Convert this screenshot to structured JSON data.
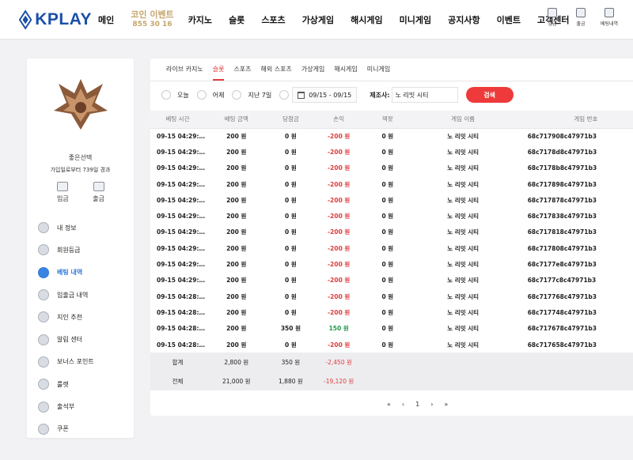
{
  "brand": {
    "name": "KPLAY"
  },
  "nav": {
    "items": [
      "메인",
      "카지노",
      "슬롯",
      "스포츠",
      "가상게임",
      "해시게임",
      "미니게임",
      "공지사항",
      "이벤트",
      "고객센터"
    ],
    "event": {
      "title": "코인 이벤트",
      "sub": "855 30 16"
    }
  },
  "header_icons": [
    "입금",
    "출금",
    "베팅내역"
  ],
  "user": {
    "name": "좋은선택",
    "since": "가입일로부터 739일 경과",
    "deposit_label": "입금",
    "withdraw_label": "출금"
  },
  "menu": {
    "items": [
      "내 정보",
      "회원등급",
      "베팅 내역",
      "입출금 내역",
      "지인 추천",
      "알림 센터",
      "보너스 포인트",
      "룰렛",
      "출석부",
      "쿠폰"
    ],
    "active_index": 2
  },
  "tabs": {
    "items": [
      "라이브 카지노",
      "슬롯",
      "스포츠",
      "해외 스포츠",
      "가상게임",
      "해시게임",
      "미니게임"
    ],
    "active_index": 1
  },
  "filters": {
    "today": "오늘",
    "yesterday": "어제",
    "last7": "지난 7일",
    "date_range": "09/15 - 09/15",
    "provider_label": "제조사:",
    "provider_value": "노 리밋 시티",
    "search_label": "검색"
  },
  "table": {
    "headers": [
      "베팅 시간",
      "베팅 금액",
      "당첨금",
      "손익",
      "잭팟",
      "게임 이름",
      "게임 번호"
    ],
    "rows": [
      [
        "09-15 04:29:…",
        "200 원",
        "0 원",
        "-200 원",
        "0 원",
        "노 리밋 시티",
        "68c717908c47971b3"
      ],
      [
        "09-15 04:29:…",
        "200 원",
        "0 원",
        "-200 원",
        "0 원",
        "노 리밋 시티",
        "68c7178d8c47971b3"
      ],
      [
        "09-15 04:29:…",
        "200 원",
        "0 원",
        "-200 원",
        "0 원",
        "노 리밋 시티",
        "68c7178b8c47971b3"
      ],
      [
        "09-15 04:29:…",
        "200 원",
        "0 원",
        "-200 원",
        "0 원",
        "노 리밋 시티",
        "68c717898c47971b3"
      ],
      [
        "09-15 04:29:…",
        "200 원",
        "0 원",
        "-200 원",
        "0 원",
        "노 리밋 시티",
        "68c717878c47971b3"
      ],
      [
        "09-15 04:29:…",
        "200 원",
        "0 원",
        "-200 원",
        "0 원",
        "노 리밋 시티",
        "68c717838c47971b3"
      ],
      [
        "09-15 04:29:…",
        "200 원",
        "0 원",
        "-200 원",
        "0 원",
        "노 리밋 시티",
        "68c717818c47971b3"
      ],
      [
        "09-15 04:29:…",
        "200 원",
        "0 원",
        "-200 원",
        "0 원",
        "노 리밋 시티",
        "68c717808c47971b3"
      ],
      [
        "09-15 04:29:…",
        "200 원",
        "0 원",
        "-200 원",
        "0 원",
        "노 리밋 시티",
        "68c7177e8c47971b3"
      ],
      [
        "09-15 04:29:…",
        "200 원",
        "0 원",
        "-200 원",
        "0 원",
        "노 리밋 시티",
        "68c7177c8c47971b3"
      ],
      [
        "09-15 04:28:…",
        "200 원",
        "0 원",
        "-200 원",
        "0 원",
        "노 리밋 시티",
        "68c717768c47971b3"
      ],
      [
        "09-15 04:28:…",
        "200 원",
        "0 원",
        "-200 원",
        "0 원",
        "노 리밋 시티",
        "68c717748c47971b3"
      ],
      [
        "09-15 04:28:…",
        "200 원",
        "350 원",
        "150 원",
        "0 원",
        "노 리밋 시티",
        "68c717678c47971b3"
      ],
      [
        "09-15 04:28:…",
        "200 원",
        "0 원",
        "-200 원",
        "0 원",
        "노 리밋 시티",
        "68c717658c47971b3"
      ]
    ],
    "summary": [
      [
        "합계",
        "2,800 원",
        "350 원",
        "-2,450 원"
      ],
      [
        "전체",
        "21,000 원",
        "1,880 원",
        "-19,120 원"
      ]
    ]
  },
  "pager": {
    "first": "«",
    "prev": "‹",
    "page": "1",
    "next": "›",
    "last": "»"
  },
  "colors": {
    "brand": "#1a4fa8",
    "accent": "#ee3a3a",
    "profit": "#1f9a4a",
    "active_menu": "#2f78d8"
  }
}
